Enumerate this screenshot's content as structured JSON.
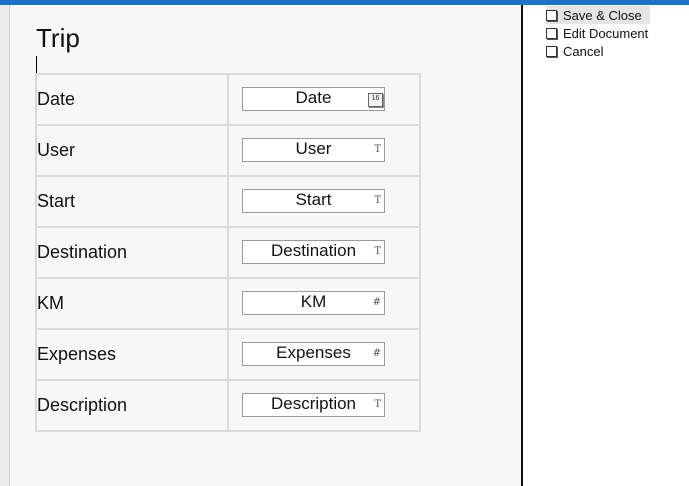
{
  "form": {
    "title": "Trip",
    "rows": [
      {
        "label": "Date",
        "value": "Date",
        "icon": "16",
        "icon_name": "calendar-icon"
      },
      {
        "label": "User",
        "value": "User",
        "icon": "T",
        "icon_name": "text-type-icon"
      },
      {
        "label": "Start",
        "value": "Start",
        "icon": "T",
        "icon_name": "text-type-icon"
      },
      {
        "label": "Destination",
        "value": "Destination",
        "icon": "T",
        "icon_name": "text-type-icon"
      },
      {
        "label": "KM",
        "value": "KM",
        "icon": "#",
        "icon_name": "number-type-icon"
      },
      {
        "label": "Expenses",
        "value": "Expenses",
        "icon": "#",
        "icon_name": "number-type-icon"
      },
      {
        "label": "Description",
        "value": "Description",
        "icon": "T",
        "icon_name": "text-type-icon"
      }
    ]
  },
  "actions": [
    {
      "label": "Save & Close"
    },
    {
      "label": "Edit Document"
    },
    {
      "label": "Cancel"
    }
  ],
  "colors": {
    "topbar": "#1a73c8",
    "document_bg": "#f7f7f7",
    "grid_line": "#dadada"
  }
}
